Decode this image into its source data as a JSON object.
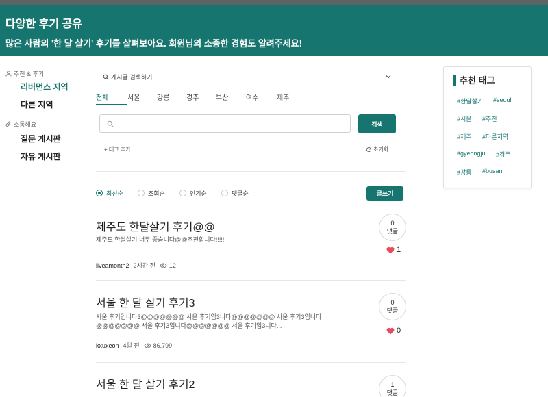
{
  "colors": {
    "brand": "#177570",
    "topline": "#5c6466",
    "heart": "#e84b5e"
  },
  "banner": {
    "title": "다양한 후기 공유",
    "subtitle": "많은 사람의 '한 달 살기' 후기를 살펴보아요. 회원님의 소중한 경험도 알려주세요!"
  },
  "sidebar": {
    "groups": [
      {
        "icon": "user-icon",
        "label": "추천 & 후기",
        "items": [
          "리버먼스 지역",
          "다른 지역"
        ]
      },
      {
        "icon": "paperclip-icon",
        "label": "소통해요",
        "items": [
          "질문 게시판",
          "자유 게시판"
        ]
      }
    ]
  },
  "search": {
    "dropdown_label": "게시글 검색하기",
    "tabs": [
      "전체",
      "서울",
      "강릉",
      "경주",
      "부산",
      "여수",
      "제주"
    ],
    "active_tab": "전체",
    "input_placeholder": "",
    "input_value": "",
    "button_label": "검색",
    "add_tag_label": "+ 태그 추가",
    "reset_label": "초기화"
  },
  "sort": {
    "options": [
      "최신순",
      "조회순",
      "인기순",
      "댓글순"
    ],
    "selected": "최신순",
    "write_label": "글쓰기"
  },
  "posts": [
    {
      "title": "제주도 한달살기 후기@@",
      "body": "제주도 한달살기 너무 좋습니다@@추천합니다!!!!!",
      "author": "liveamonth2",
      "time": "2시간 전",
      "views": "12",
      "comments": "0",
      "comments_label": "댓글",
      "likes": "1"
    },
    {
      "title": "서울 한 달 살기 후기3",
      "body": "서울 후기입니다3@@@@@@@ 서울 후기입3니다@@@@@@@ 서울 후기3입니다@@@@@@@ 서울 후기3입니다@@@@@@@ 서울 후기입3니다...",
      "author": "kxuxeon",
      "time": "4일 전",
      "views": "86,799",
      "comments": "0",
      "comments_label": "댓글",
      "likes": "0"
    },
    {
      "title": "서울 한 달 살기 후기2",
      "comments": "1",
      "comments_label": "댓글"
    }
  ],
  "tag_card": {
    "title": "추천 태그",
    "tags": [
      "#한달살기",
      "#seoul",
      "#서울",
      "#추천",
      "#제주",
      "#다른지역",
      "#gyeongju",
      "#경주",
      "#강릉",
      "#busan"
    ]
  }
}
